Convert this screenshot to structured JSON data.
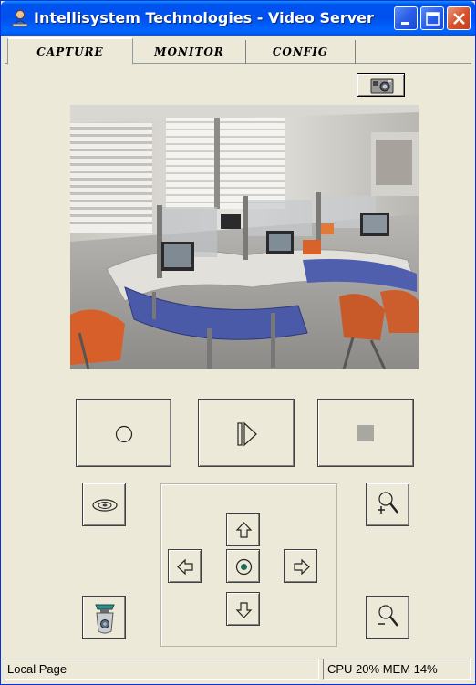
{
  "window": {
    "title": "Intellisystem Technologies - Video Server",
    "icon": "server-app-icon",
    "controls": [
      "minimize-icon",
      "maximize-icon",
      "close-icon"
    ]
  },
  "tabs": [
    {
      "label": "CAPTURE",
      "active": true
    },
    {
      "label": "MONITOR",
      "active": false
    },
    {
      "label": "CONFIG",
      "active": false
    }
  ],
  "capture": {
    "snapshot_icon": "camera-icon",
    "video_feed": "office-camera-feed",
    "transport": [
      {
        "name": "record",
        "icon": "record-circle-icon"
      },
      {
        "name": "play",
        "icon": "play-triangle-icon"
      },
      {
        "name": "stop",
        "icon": "stop-square-icon"
      }
    ],
    "ptz": {
      "up_icon": "arrow-up-icon",
      "down_icon": "arrow-down-icon",
      "left_icon": "arrow-left-icon",
      "right_icon": "arrow-right-icon",
      "center_icon": "home-target-icon"
    },
    "iris_icon": "iris-lens-icon",
    "zoom_in_icon": "zoom-in-icon",
    "zoom_out_icon": "zoom-out-icon",
    "camera_device_icon": "camera-device-icon"
  },
  "status": {
    "left": "Local Page",
    "right": "CPU 20% MEM 14%"
  },
  "colors": {
    "titlebar": "#0053ee",
    "face": "#ece9d8",
    "stop_gray": "#a8a8a0"
  }
}
